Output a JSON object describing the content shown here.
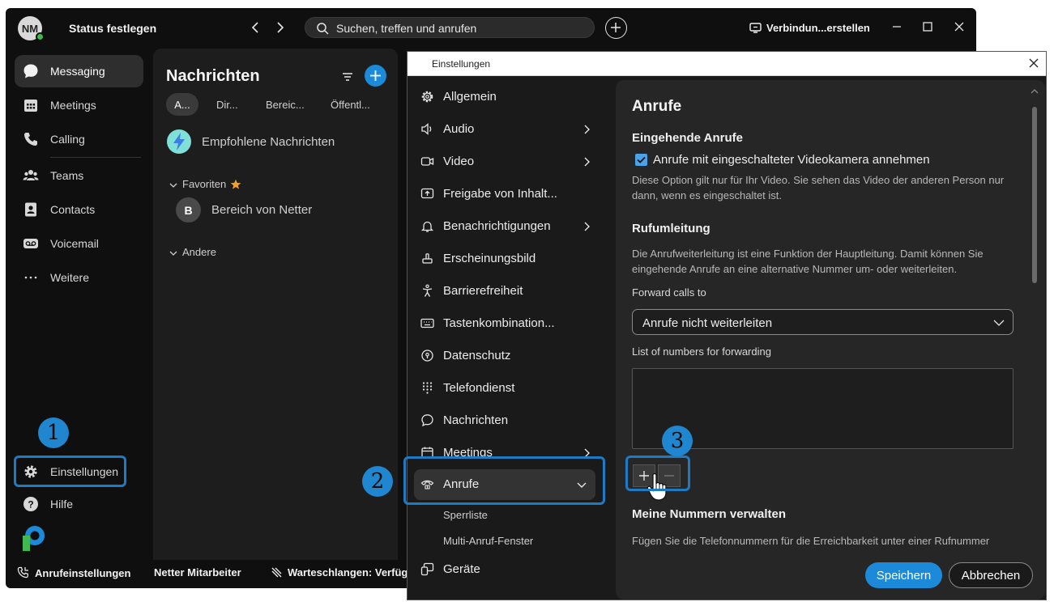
{
  "titlebar": {
    "avatar_initials": "NM",
    "status": "Status festlegen",
    "search_placeholder": "Suchen, treffen und anrufen",
    "connect_label": "Verbindun...erstellen"
  },
  "rail": {
    "items": [
      {
        "label": "Messaging",
        "icon": "chat-bubble-icon"
      },
      {
        "label": "Meetings",
        "icon": "calendar-icon"
      },
      {
        "label": "Calling",
        "icon": "phone-icon"
      },
      {
        "label": "Teams",
        "icon": "people-icon"
      },
      {
        "label": "Contacts",
        "icon": "contact-card-icon"
      },
      {
        "label": "Voicemail",
        "icon": "voicemail-icon"
      },
      {
        "label": "Weitere",
        "icon": "more-dots-icon"
      }
    ],
    "settings_label": "Einstellungen",
    "help_label": "Hilfe"
  },
  "messages": {
    "title": "Nachrichten",
    "filters": [
      "A...",
      "Dir...",
      "Bereic...",
      "Öffentl..."
    ],
    "recommended": "Empfohlene Nachrichten",
    "favorites_label": "Favoriten",
    "favorite_item_initial": "B",
    "favorite_item": "Bereich von Netter",
    "others_label": "Andere"
  },
  "bottom_bar": {
    "call_settings": "Anrufeinstellungen",
    "user": "Netter Mitarbeiter",
    "queues": "Warteschlangen: Verfüg"
  },
  "dialog": {
    "title": "Einstellungen",
    "categories": [
      {
        "label": "Allgemein",
        "icon": "gear-icon"
      },
      {
        "label": "Audio",
        "icon": "speaker-icon"
      },
      {
        "label": "Video",
        "icon": "video-camera-icon"
      },
      {
        "label": "Freigabe von Inhalt...",
        "icon": "share-screen-icon"
      },
      {
        "label": "Benachrichtigungen",
        "icon": "bell-icon"
      },
      {
        "label": "Erscheinungsbild",
        "icon": "paint-icon"
      },
      {
        "label": "Barrierefreiheit",
        "icon": "accessibility-icon"
      },
      {
        "label": "Tastenkombination...",
        "icon": "keyboard-icon"
      },
      {
        "label": "Datenschutz",
        "icon": "privacy-icon"
      },
      {
        "label": "Telefondienst",
        "icon": "dialpad-icon"
      },
      {
        "label": "Nachrichten",
        "icon": "chat-bubble-icon"
      },
      {
        "label": "Meetings",
        "icon": "calendar-icon"
      },
      {
        "label": "Anrufe",
        "icon": "handset-icon"
      }
    ],
    "subcategories": [
      "Sperrliste",
      "Multi-Anruf-Fenster"
    ],
    "devices_label": "Geräte",
    "content": {
      "heading": "Anrufe",
      "incoming_heading": "Eingehende Anrufe",
      "video_checkbox_label": "Anrufe mit eingeschalteter Videokamera annehmen",
      "video_checkbox_checked": true,
      "video_desc": "Diese Option gilt nur für Ihr Video. Sie sehen das Video der anderen Person nur dann, wenn es eingeschaltet ist.",
      "forward_heading": "Rufumleitung",
      "forward_desc": "Die Anrufweiterleitung ist eine Funktion der Hauptleitung. Damit können Sie eingehende Anrufe an eine alternative Nummer um- oder weiterleiten.",
      "forward_to_label": "Forward calls to",
      "forward_select_value": "Anrufe nicht weiterleiten",
      "list_label": "List of numbers for forwarding",
      "my_numbers_heading": "Meine Nummern verwalten",
      "my_numbers_desc": "Fügen Sie die Telefonnummern für die Erreichbarkeit unter einer Rufnummer"
    },
    "save_label": "Speichern",
    "cancel_label": "Abbrechen"
  },
  "callouts": [
    "1",
    "2",
    "3"
  ],
  "colors": {
    "accent": "#1c8ad8",
    "callout": "#1f7ac4",
    "presence": "#3fb950"
  }
}
